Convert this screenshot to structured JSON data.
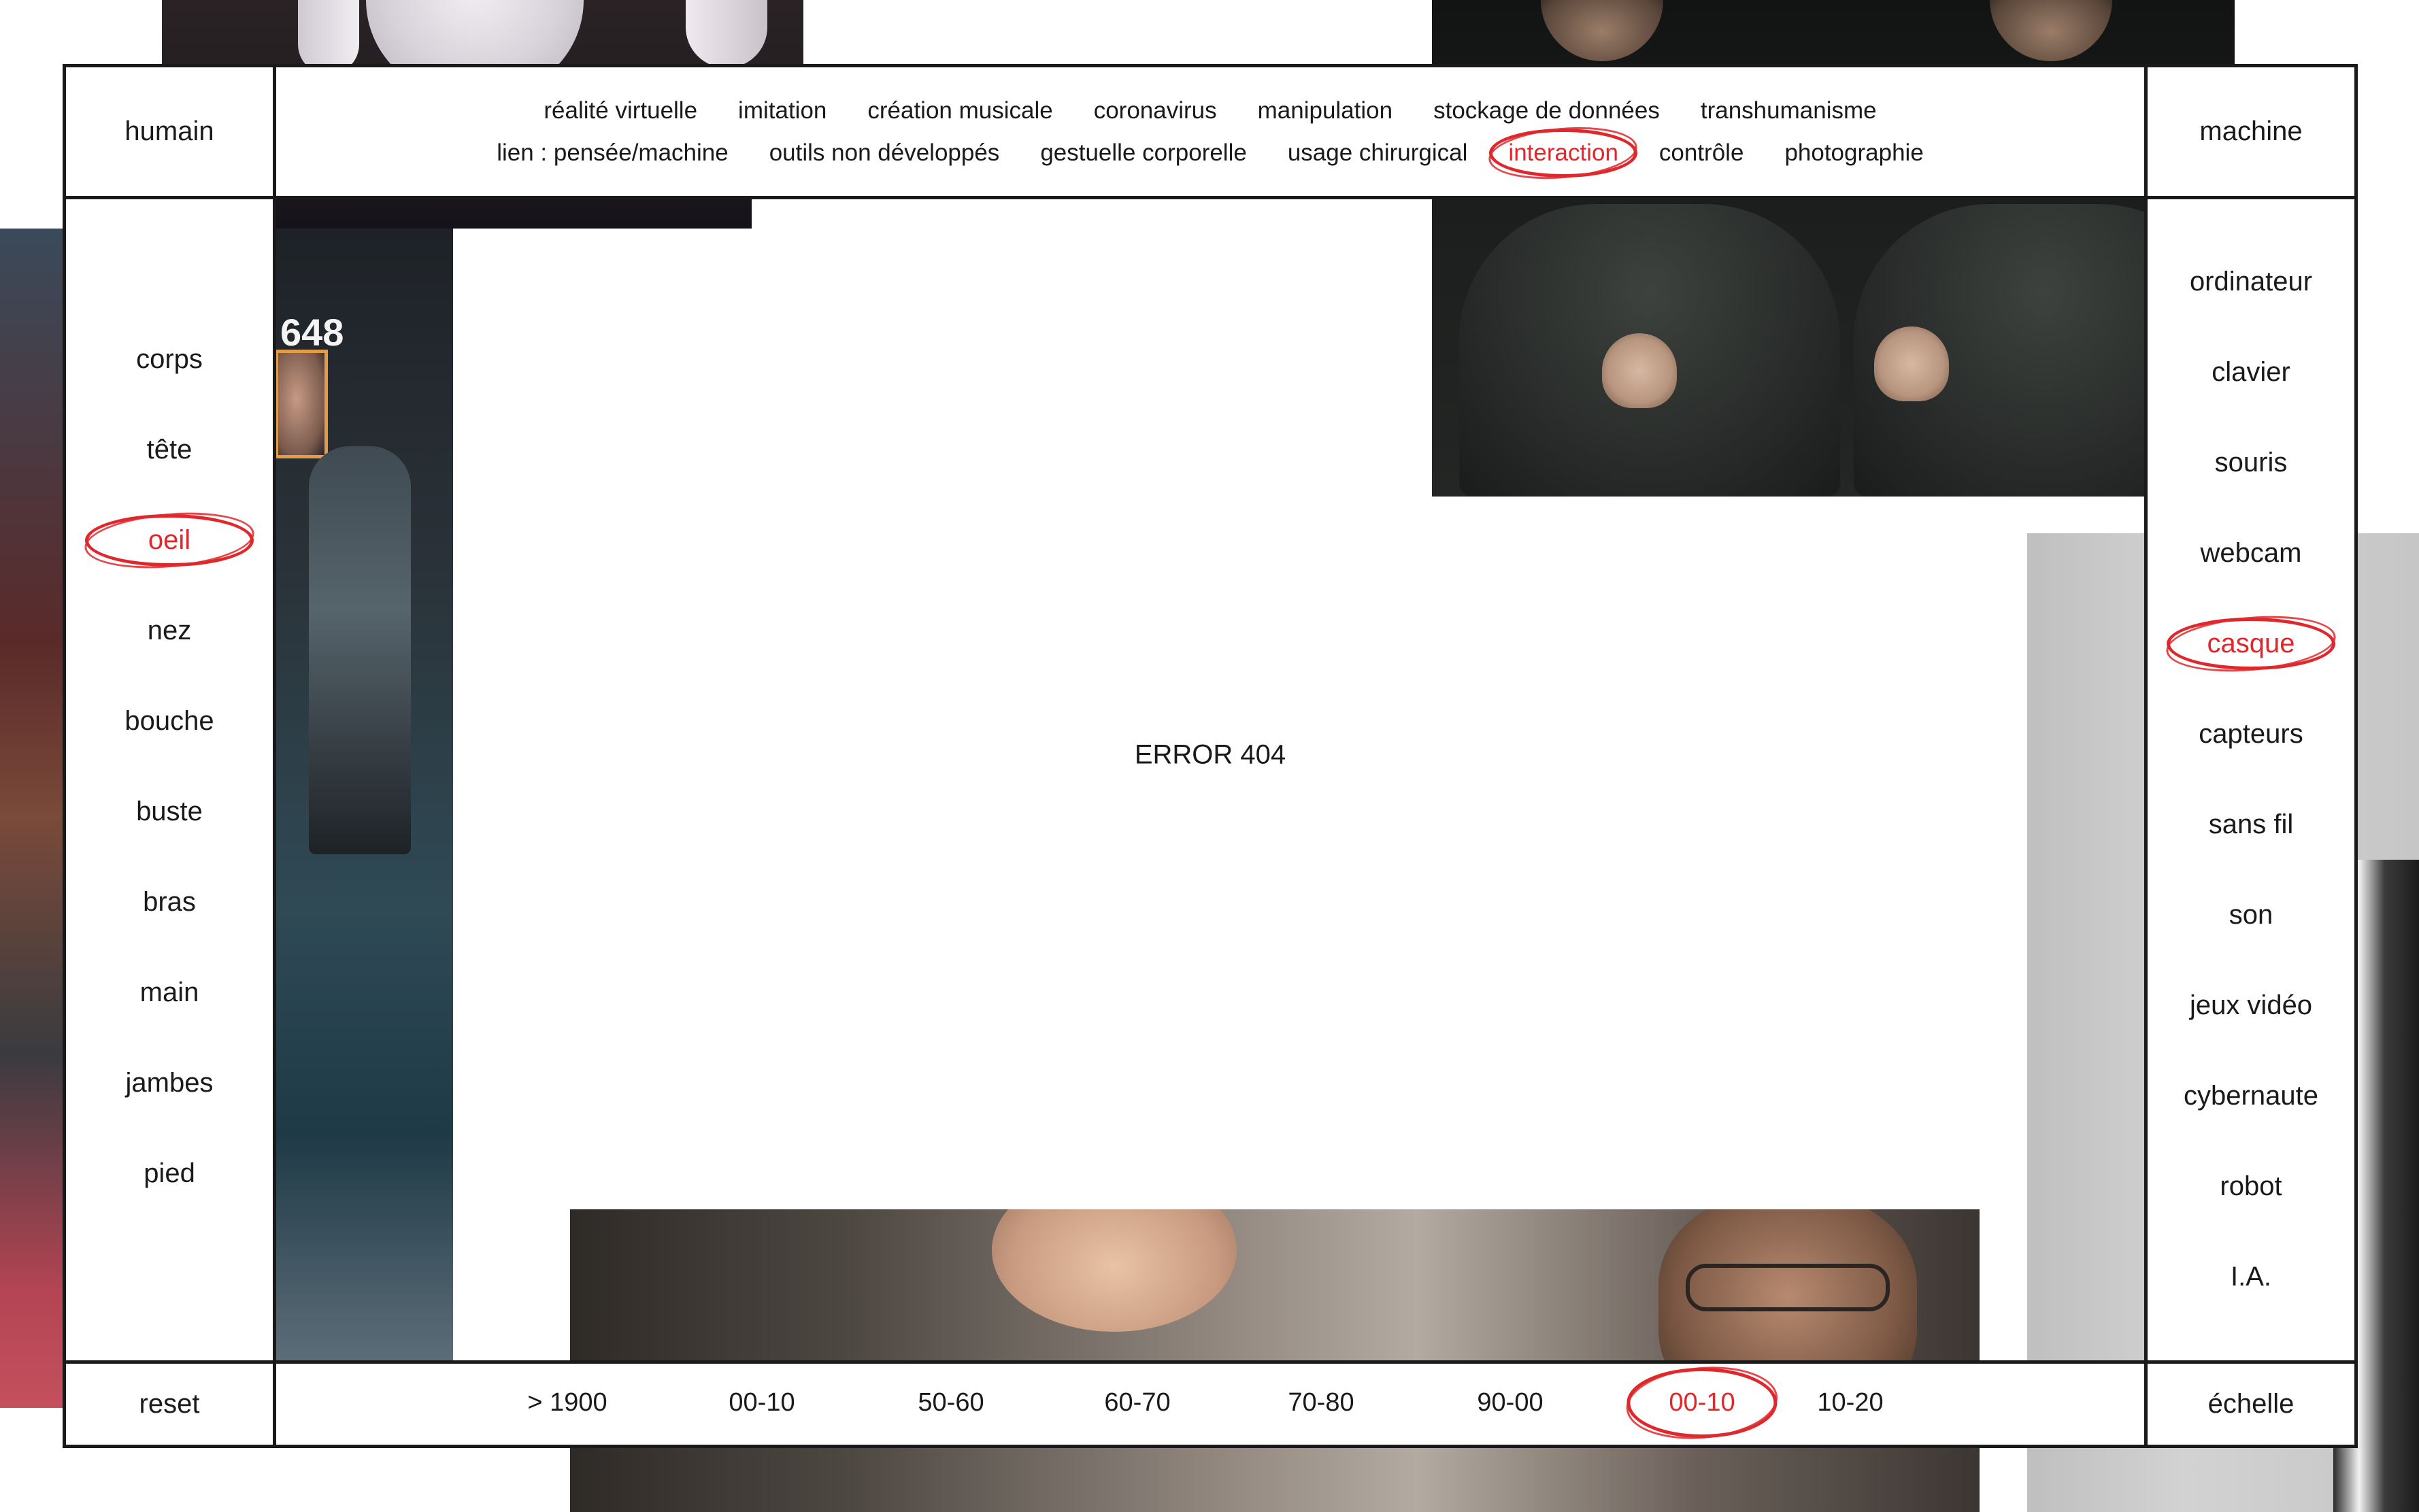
{
  "corners": {
    "top_left": "humain",
    "top_right": "machine",
    "bottom_left": "reset",
    "bottom_right": "échelle"
  },
  "topics": {
    "row1": [
      "réalité virtuelle",
      "imitation",
      "création musicale",
      "coronavirus",
      "manipulation",
      "stockage de données",
      "transhumanisme"
    ],
    "row2": [
      "lien : pensée/machine",
      "outils non développés",
      "gestuelle corporelle",
      "usage chirurgical",
      "interaction",
      "contrôle",
      "photographie"
    ],
    "selected": "interaction"
  },
  "human_parts": {
    "items": [
      "corps",
      "tête",
      "oeil",
      "nez",
      "bouche",
      "buste",
      "bras",
      "main",
      "jambes",
      "pied"
    ],
    "selected": "oeil"
  },
  "machine_parts": {
    "items": [
      "ordinateur",
      "clavier",
      "souris",
      "webcam",
      "casque",
      "capteurs",
      "sans fil",
      "son",
      "jeux vidéo",
      "cybernaute",
      "robot",
      "I.A."
    ],
    "selected": "casque"
  },
  "periods": {
    "items": [
      "> 1900",
      "00-10",
      "50-60",
      "60-70",
      "70-80",
      "90-00",
      "00-10",
      "10-20"
    ],
    "selected_index": 6
  },
  "main": {
    "message": "ERROR 404",
    "photo_label": "648"
  },
  "colors": {
    "accent": "#e0282c",
    "line": "#1a1a1a",
    "background": "#ffffff"
  }
}
